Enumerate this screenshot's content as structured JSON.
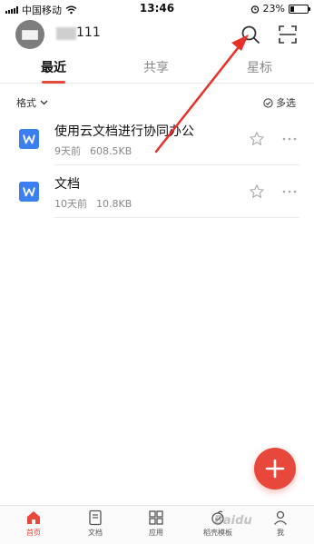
{
  "status_bar": {
    "carrier": "中国移动",
    "time": "13:46",
    "battery_percent": "23%",
    "battery_level": 0.23,
    "icons": [
      "signal-icon",
      "wifi-icon",
      "alarm-icon",
      "battery-icon"
    ]
  },
  "header": {
    "username": "111",
    "avatar_icon": "user-avatar",
    "search_icon": "search-icon",
    "scan_icon": "scan-icon"
  },
  "tabs": [
    {
      "label": "最近",
      "active": true
    },
    {
      "label": "共享",
      "active": false
    },
    {
      "label": "星标",
      "active": false
    }
  ],
  "toolbar": {
    "filter_label": "格式",
    "multi_select_label": "多选"
  },
  "files": [
    {
      "name": "使用云文档进行协同办公",
      "time": "9天前",
      "size": "608.5KB",
      "icon": "word-doc-icon"
    },
    {
      "name": "文档",
      "time": "10天前",
      "size": "10.8KB",
      "icon": "word-doc-icon"
    }
  ],
  "fab": {
    "icon": "plus-icon"
  },
  "bottom_nav": [
    {
      "label": "首页",
      "icon": "home-icon",
      "active": true
    },
    {
      "label": "文档",
      "icon": "document-icon",
      "active": false
    },
    {
      "label": "应用",
      "icon": "apps-grid-icon",
      "active": false
    },
    {
      "label": "稻壳模板",
      "icon": "template-icon",
      "active": false
    },
    {
      "label": "我",
      "icon": "profile-icon",
      "active": false
    }
  ],
  "watermark": "Baidu",
  "colors": {
    "accent": "#e8473c",
    "doc_icon": "#3b7ff0",
    "annotation": "#e8312b"
  }
}
